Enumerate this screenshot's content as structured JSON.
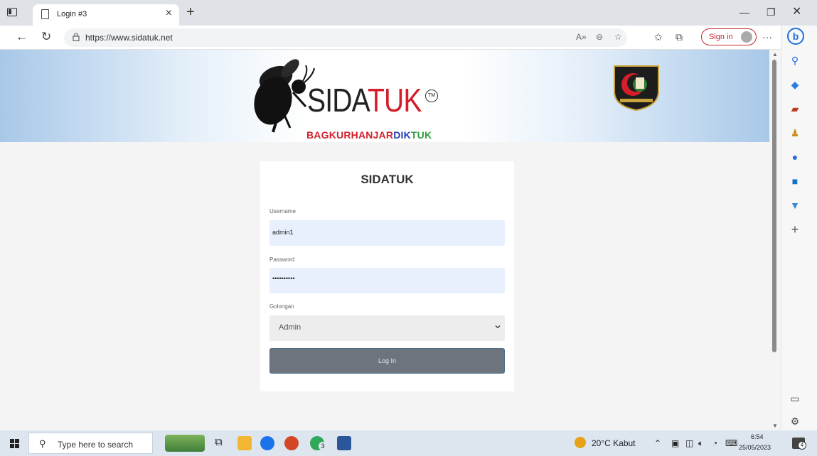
{
  "browser": {
    "tab_title": "Login #3",
    "url": "https://www.sidatuk.net",
    "signin_label": "Sign in"
  },
  "header": {
    "brand_part1": "SIDA",
    "brand_part2": "TUK",
    "tm": "TM",
    "sub_part1": "BAGKURHANJAR",
    "sub_part2": "DIK",
    "sub_part3": "TUK"
  },
  "login": {
    "title": "SIDATUK",
    "username_label": "Username",
    "username_value": "admin1",
    "password_label": "Password",
    "password_value": "••••••••••",
    "golongan_label": "Golongan",
    "golongan_value": "Admin",
    "login_button": "Log In"
  },
  "taskbar": {
    "search_placeholder": "Type here to search",
    "weather": "20°C  Kabut",
    "time": "6:54",
    "date": "25/05/2023",
    "notification_count": "4",
    "badge_count": "3"
  },
  "colors": {
    "brand_red": "#d21f2a",
    "brand_blue": "#1f3fb0",
    "brand_green": "#2e9e3e",
    "field_bg": "#e8f0fe",
    "button_bg": "#6d747e"
  }
}
